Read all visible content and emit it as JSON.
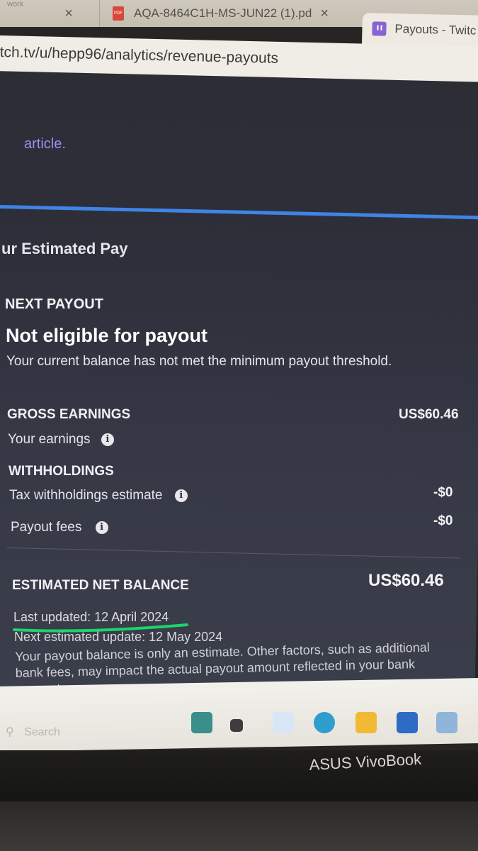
{
  "browser": {
    "tabs": [
      {
        "label": "work",
        "close": "×"
      },
      {
        "label": "AQA-8464C1H-MS-JUN22 (1).pd",
        "close": "×",
        "icon": "pdf-icon"
      },
      {
        "label": "Payouts - Twitc",
        "icon": "twitch-icon",
        "active": true
      }
    ],
    "url": "tch.tv/u/hepp96/analytics/revenue-payouts"
  },
  "page": {
    "link_text": "article.",
    "section_title": "ur Estimated Pay",
    "next_payout": {
      "heading": "NEXT PAYOUT",
      "status": "Not eligible for payout",
      "message": "Your current balance has not met the minimum payout threshold."
    },
    "gross": {
      "heading": "GROSS EARNINGS",
      "value": "US$60.46",
      "earnings_label": "Your earnings"
    },
    "withholdings": {
      "heading": "WITHHOLDINGS",
      "tax_label": "Tax withholdings estimate",
      "tax_value": "-$0",
      "fees_label": "Payout fees",
      "fees_value": "-$0"
    },
    "net": {
      "heading": "ESTIMATED NET BALANCE",
      "value": "US$60.46",
      "last_updated": "Last updated: 12 April 2024",
      "next_update": "Next estimated update: 12 May 2024",
      "note": "Your payout balance is only an estimate. Other factors, such as additional bank fees, may impact the actual payout amount reflected in your bank account."
    },
    "info_glyph": "i"
  },
  "taskbar": {
    "search_placeholder": "Search",
    "icons": [
      "widgets-icon",
      "task-view-icon",
      "copilot-icon",
      "edge-icon",
      "file-explorer-icon",
      "word-icon",
      "settings-icon"
    ]
  },
  "laptop": {
    "brand": "ASUS VivoBook"
  },
  "colors": {
    "link": "#9d8ff0",
    "accent_rule": "#3f84e6",
    "highlight": "#19d66b",
    "page_bg": "#2e2f3a"
  }
}
